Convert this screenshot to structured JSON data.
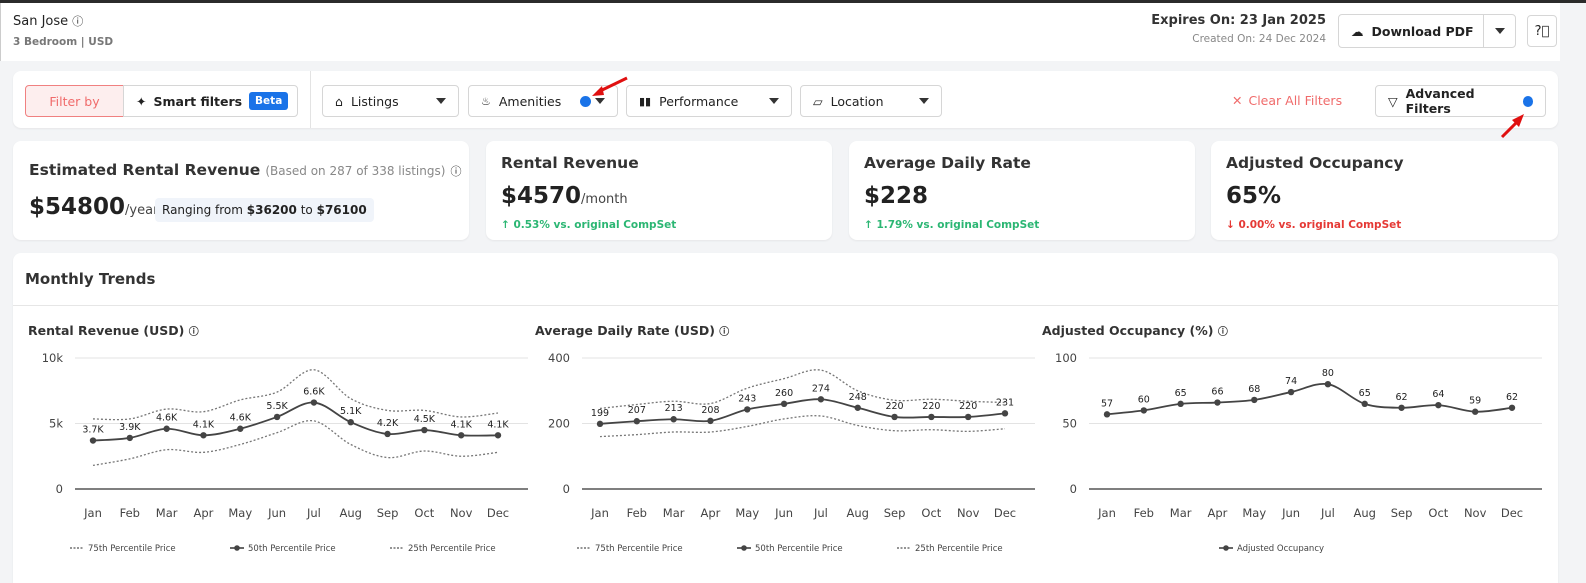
{
  "header": {
    "title": "San Jose",
    "subtitle": "3 Bedroom | USD",
    "expires": "Expires On: 23 Jan 2025",
    "created": "Created On: 24 Dec 2024",
    "download_label": "Download PDF"
  },
  "filters": {
    "filter_by": "Filter by",
    "smart": "Smart filters",
    "beta": "Beta",
    "listings": "Listings",
    "amenities": "Amenities",
    "performance": "Performance",
    "location": "Location",
    "clear": "Clear All Filters",
    "advanced": "Advanced Filters"
  },
  "kpis": {
    "est": {
      "title": "Estimated Rental Revenue",
      "note": "(Based on 287 of 338 listings)",
      "value": "$54800",
      "unit": "/year",
      "range_prefix": "Ranging from",
      "range_low": "$36200",
      "range_to": "to",
      "range_high": "$76100"
    },
    "rev": {
      "title": "Rental Revenue",
      "value": "$4570",
      "unit": "/month",
      "change": "↑ 0.53% vs. original CompSet"
    },
    "adr": {
      "title": "Average Daily Rate",
      "value": "$228",
      "change": "↑ 1.79% vs. original CompSet"
    },
    "occ": {
      "title": "Adjusted Occupancy",
      "value": "65%",
      "change": "↓ 0.00% vs. original CompSet"
    }
  },
  "colors": {
    "positive": "#2bb673",
    "negative": "#e53935",
    "accent": "#1a73e8",
    "danger_text": "#f06b6b"
  },
  "trends": {
    "title": "Monthly Trends"
  },
  "chart_data": [
    {
      "type": "line",
      "title": "Rental Revenue (USD)",
      "categories": [
        "Jan",
        "Feb",
        "Mar",
        "Apr",
        "May",
        "Jun",
        "Jul",
        "Aug",
        "Sep",
        "Oct",
        "Nov",
        "Dec"
      ],
      "ylim": [
        0,
        10000
      ],
      "yticks": [
        "0",
        "5k",
        "10k"
      ],
      "ytick_values": [
        0,
        5000,
        10000
      ],
      "series": [
        {
          "name": "75th Percentile Price",
          "style": "dotted",
          "values": [
            5350,
            5350,
            6100,
            5900,
            6800,
            7400,
            9100,
            6900,
            6000,
            6000,
            5500,
            5800
          ]
        },
        {
          "name": "50th Percentile Price",
          "style": "solid",
          "values": [
            3700,
            3900,
            4600,
            4100,
            4600,
            5500,
            6600,
            5100,
            4200,
            4500,
            4100,
            4100
          ],
          "labels": [
            "3.7K",
            "3.9K",
            "4.6K",
            "4.1K",
            "4.6K",
            "5.5K",
            "6.6K",
            "5.1K",
            "4.2K",
            "4.5K",
            "4.1K",
            "4.1K"
          ]
        },
        {
          "name": "25th Percentile Price",
          "style": "dotted",
          "values": [
            1800,
            2300,
            3000,
            2800,
            3400,
            4300,
            5200,
            3400,
            2400,
            2900,
            2500,
            2800
          ]
        }
      ]
    },
    {
      "type": "line",
      "title": "Average Daily Rate (USD)",
      "categories": [
        "Jan",
        "Feb",
        "Mar",
        "Apr",
        "May",
        "Jun",
        "Jul",
        "Aug",
        "Sep",
        "Oct",
        "Nov",
        "Dec"
      ],
      "ylim": [
        0,
        400
      ],
      "yticks": [
        "0",
        "200",
        "400"
      ],
      "ytick_values": [
        0,
        200,
        400
      ],
      "series": [
        {
          "name": "75th Percentile Price",
          "style": "dotted",
          "values": [
            246,
            258,
            268,
            261,
            308,
            337,
            363,
            300,
            271,
            274,
            268,
            264
          ]
        },
        {
          "name": "50th Percentile Price",
          "style": "solid",
          "values": [
            199,
            207,
            213,
            208,
            243,
            260,
            274,
            248,
            220,
            220,
            220,
            231
          ],
          "labels": [
            "199",
            "207",
            "213",
            "208",
            "243",
            "260",
            "274",
            "248",
            "220",
            "220",
            "220",
            "231"
          ]
        },
        {
          "name": "25th Percentile Price",
          "style": "dotted",
          "values": [
            160,
            166,
            174,
            174,
            191,
            214,
            223,
            194,
            178,
            181,
            176,
            184
          ]
        }
      ]
    },
    {
      "type": "line",
      "title": "Adjusted Occupancy (%)",
      "categories": [
        "Jan",
        "Feb",
        "Mar",
        "Apr",
        "May",
        "Jun",
        "Jul",
        "Aug",
        "Sep",
        "Oct",
        "Nov",
        "Dec"
      ],
      "ylim": [
        0,
        100
      ],
      "yticks": [
        "0",
        "50",
        "100"
      ],
      "ytick_values": [
        0,
        50,
        100
      ],
      "series": [
        {
          "name": "Adjusted Occupancy",
          "style": "solid",
          "values": [
            57,
            60,
            65,
            66,
            68,
            74,
            80,
            65,
            62,
            64,
            59,
            62
          ],
          "labels": [
            "57",
            "60",
            "65",
            "66",
            "68",
            "74",
            "80",
            "65",
            "62",
            "64",
            "59",
            "62"
          ]
        }
      ]
    }
  ]
}
